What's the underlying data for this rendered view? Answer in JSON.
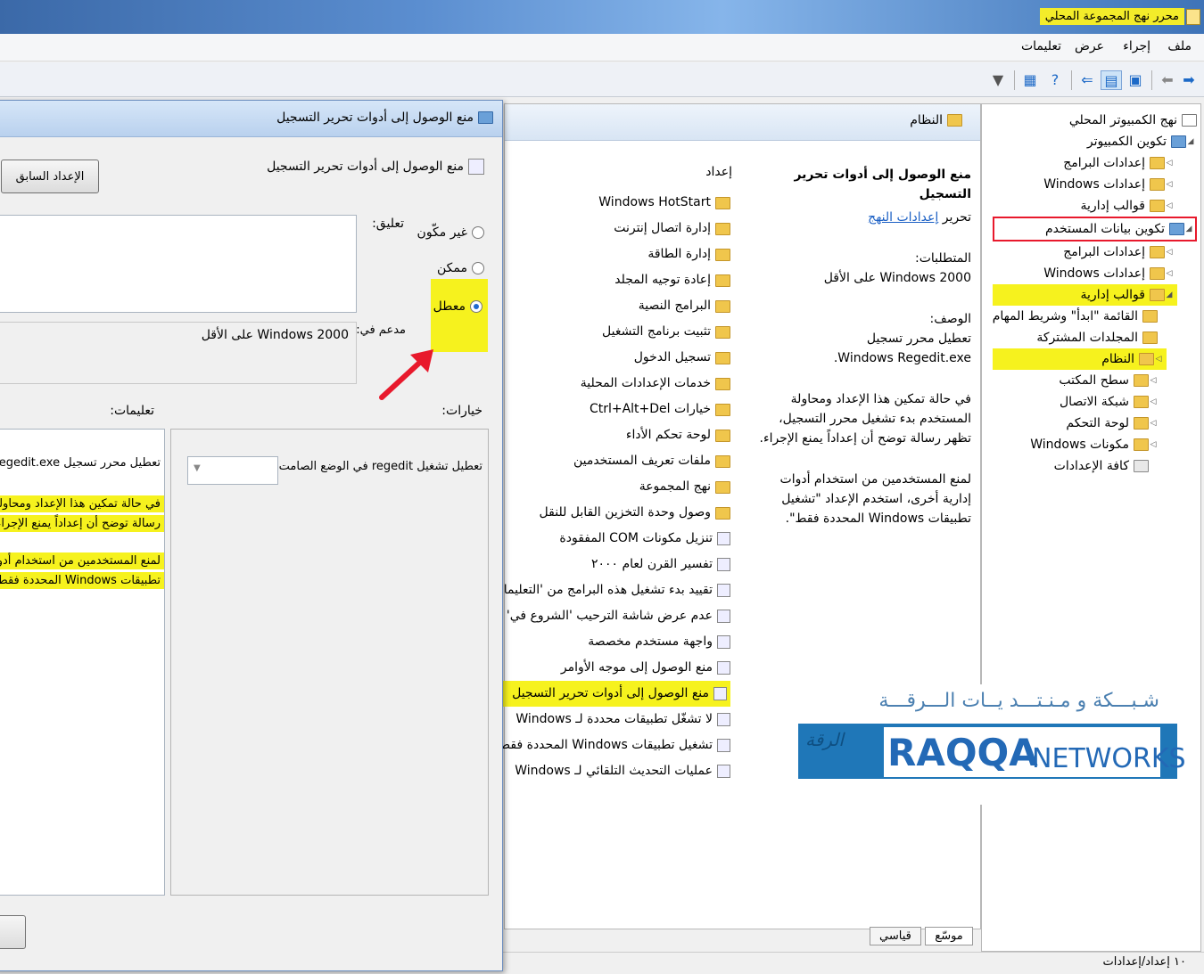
{
  "window": {
    "title": "محرر نهج المجموعة المحلي"
  },
  "menu": [
    "ملف",
    "إجراء",
    "عرض",
    "تعليمات"
  ],
  "tree": {
    "root": "نهج الكمبيوتر المحلي",
    "computer_config": "تكوين الكمبيوتر",
    "software_settings": "إعدادات البرامج",
    "windows_settings": "إعدادات Windows",
    "admin_templates": "قوالب إدارية",
    "user_config": "تكوين بيانات المستخدم",
    "user_software_settings": "إعدادات البرامج",
    "user_windows_settings": "إعدادات Windows",
    "user_admin_templates": "قوالب إدارية",
    "start_menu": "القائمة \"ابدأ\" وشريط المهام",
    "shared_folders": "المجلدات المشتركة",
    "system": "النظام",
    "desktop": "سطح المكتب",
    "network": "شبكة الاتصال",
    "control_panel": "لوحة التحكم",
    "windows_components": "مكونات Windows",
    "all_settings": "كافة الإعدادات"
  },
  "middle": {
    "header": "النظام",
    "policy_title": "منع الوصول إلى أدوات تحرير التسجيل",
    "edit_prefix": "تحرير",
    "edit_link": "إعدادات النهج",
    "requirements_label": "المتطلبات:",
    "requirements_value": "Windows 2000 على الأقل",
    "description_label": "الوصف:",
    "description_1": "تعطيل محرر تسجيل Windows Regedit.exe.",
    "description_2": "في حالة تمكين هذا الإعداد ومحاولة المستخدم بدء تشغيل محرر التسجيل، تظهر رسالة توضح أن إعداداً يمنع الإجراء.",
    "description_3": "لمنع المستخدمين من استخدام أدوات إدارية أخرى، استخدم الإعداد \"تشغيل تطبيقات Windows المحددة فقط\".",
    "settings_header": "إعداد",
    "settings": [
      "Windows HotStart",
      "إدارة اتصال إنترنت",
      "إدارة الطاقة",
      "إعادة توجيه المجلد",
      "البرامج النصية",
      "تثبيت برنامج التشغيل",
      "تسجيل الدخول",
      "خدمات الإعدادات المحلية",
      "خيارات Ctrl+Alt+Del",
      "لوحة تحكم الأداء",
      "ملفات تعريف المستخدمين",
      "نهج المجموعة",
      "وصول وحدة التخزين القابل للنقل",
      "تنزيل مكونات COM المفقودة",
      "تفسير القرن لعام ٢٠٠٠",
      "تقييد بدء تشغيل هذه البرامج من 'التعليمات",
      "عدم عرض شاشة الترحيب 'الشروع في' عند تسجيل",
      "واجهة مستخدم مخصصة",
      "منع الوصول إلى موجه الأوامر",
      "منع الوصول إلى أدوات تحرير التسجيل",
      "لا تشغّل تطبيقات محددة لـ Windows",
      "تشغيل تطبيقات Windows المحددة فقط",
      "عمليات التحديث التلقائي لـ Windows"
    ],
    "tabs": [
      "موسّع",
      "قياسي"
    ]
  },
  "banner": {
    "arabic": "شـبـــكة و مـنـتـــد يــات الـــرقـــة",
    "brand": "RAQQA",
    "brand2": "NETWORKS",
    "logo_script": "الرقة"
  },
  "status": "١٠ إعداد/إعدادات",
  "dialog": {
    "title": "منع الوصول إلى أدوات تحرير التسجيل",
    "inner_title": "منع الوصول إلى أدوات تحرير التسجيل",
    "prev_button": "الإعداد السابق",
    "radio_not_configured": "غير مكّون",
    "radio_enabled": "ممكن",
    "radio_disabled": "معطل",
    "comment_label": "تعليق:",
    "supported_label": "مدعم في:",
    "supported_value": "Windows 2000 على الأقل",
    "options_label": "خيارات:",
    "help_label": "تعليمات:",
    "option_text": "تعطيل تشغيل regedit في الوضع الصامت؟",
    "help_1": "تعطيل محرر تسجيل Windows Regedit.exe",
    "help_2a": "في حالة تمكين هذا الإعداد ومحاولة",
    "help_2b": "رسالة توضح أن إعداداً يمنع الإجراء",
    "help_3a": "لمنع المستخدمين من استخدام أدوات",
    "help_3b": "تطبيقات Windows المحددة فقط\"."
  },
  "colors": {
    "highlight": "#f6f21e",
    "annotation_red": "#e8192c",
    "link": "#1a5fc4"
  }
}
